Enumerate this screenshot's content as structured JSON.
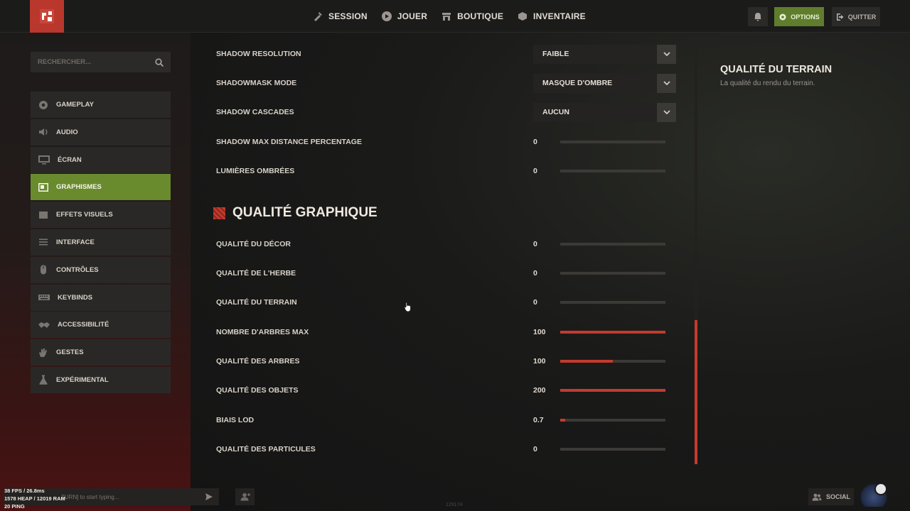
{
  "topbar": {
    "nav": [
      {
        "label": "SESSION",
        "icon": "session-icon"
      },
      {
        "label": "JOUER",
        "icon": "play-icon"
      },
      {
        "label": "BOUTIQUE",
        "icon": "store-icon"
      },
      {
        "label": "INVENTAIRE",
        "icon": "inventory-icon"
      }
    ],
    "options_label": "OPTIONS",
    "quit_label": "QUITTER"
  },
  "search": {
    "placeholder": "RECHERCHER..."
  },
  "sidebar": {
    "items": [
      {
        "label": "GAMEPLAY"
      },
      {
        "label": "AUDIO"
      },
      {
        "label": "ÉCRAN"
      },
      {
        "label": "GRAPHISMES"
      },
      {
        "label": "EFFETS VISUELS"
      },
      {
        "label": "INTERFACE"
      },
      {
        "label": "CONTRÔLES"
      },
      {
        "label": "KEYBINDS"
      },
      {
        "label": "ACCESSIBILITÉ"
      },
      {
        "label": "GESTES"
      },
      {
        "label": "EXPÉRIMENTAL"
      }
    ],
    "active_index": 3
  },
  "settings": {
    "dropdowns": [
      {
        "label": "SHADOW RESOLUTION",
        "value": "FAIBLE"
      },
      {
        "label": "SHADOWMASK MODE",
        "value": "MASQUE D'OMBRE"
      },
      {
        "label": "SHADOW CASCADES",
        "value": "AUCUN"
      }
    ],
    "sliders_top": [
      {
        "label": "SHADOW MAX DISTANCE PERCENTAGE",
        "value": "0",
        "fraction": 0
      },
      {
        "label": "LUMIÈRES OMBRÉES",
        "value": "0",
        "fraction": 0
      }
    ],
    "section_title": "QUALITÉ GRAPHIQUE",
    "sliders": [
      {
        "label": "QUALITÉ DU DÉCOR",
        "value": "0",
        "fraction": 0
      },
      {
        "label": "QUALITÉ DE L'HERBE",
        "value": "0",
        "fraction": 0
      },
      {
        "label": "QUALITÉ DU TERRAIN",
        "value": "0",
        "fraction": 0
      },
      {
        "label": "NOMBRE D'ARBRES MAX",
        "value": "100",
        "fraction": 1.0
      },
      {
        "label": "QUALITÉ DES ARBRES",
        "value": "100",
        "fraction": 0.5
      },
      {
        "label": "QUALITÉ DES OBJETS",
        "value": "200",
        "fraction": 1.0
      },
      {
        "label": "BIAIS LOD",
        "value": "0.7",
        "fraction": 0.05
      },
      {
        "label": "QUALITÉ DES PARTICULES",
        "value": "0",
        "fraction": 0
      }
    ]
  },
  "info": {
    "title": "QUALITÉ DU TERRAIN",
    "description": "La qualité du rendu du terrain."
  },
  "bottom": {
    "chat_placeholder": "TURN] to start typing...",
    "stats": [
      "38 FPS / 26.8ms",
      "1578 HEAP / 12019 RAM",
      "20 PING"
    ],
    "build": "129174",
    "social_label": "SOCIAL"
  },
  "colors": {
    "accent_green": "#6a8a2e",
    "accent_red": "#c53a2e",
    "logo_red": "#b9372c"
  }
}
